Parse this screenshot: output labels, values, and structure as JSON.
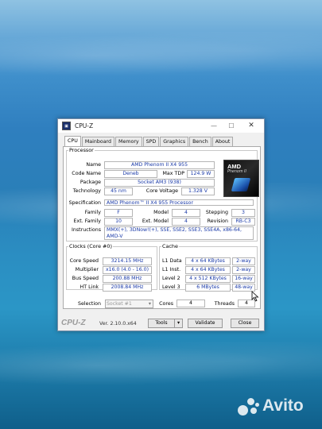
{
  "window": {
    "title": "CPU-Z"
  },
  "tabs": [
    "CPU",
    "Mainboard",
    "Memory",
    "SPD",
    "Graphics",
    "Bench",
    "About"
  ],
  "processor": {
    "legend": "Processor",
    "name_label": "Name",
    "name": "AMD Phenom II X4 955",
    "codename_label": "Code Name",
    "codename": "Deneb",
    "maxtdp_label": "Max TDP",
    "maxtdp": "124.9 W",
    "package_label": "Package",
    "package": "Socket AM3 (938)",
    "technology_label": "Technology",
    "technology": "45 nm",
    "corevoltage_label": "Core Voltage",
    "corevoltage": "1.328 V",
    "spec_label": "Specification",
    "spec": "AMD Phenom™ II X4 955 Processor",
    "family_label": "Family",
    "family": "F",
    "model_label": "Model",
    "model": "4",
    "stepping_label": "Stepping",
    "stepping": "3",
    "extfamily_label": "Ext. Family",
    "extfamily": "10",
    "extmodel_label": "Ext. Model",
    "extmodel": "4",
    "revision_label": "Revision",
    "revision": "RB-C3",
    "instructions_label": "Instructions",
    "instructions_line1": "MMX(+), 3DNow!(+), SSE, SSE2, SSE3, SSE4A, x86-64,",
    "instructions_line2": "AMD-V",
    "logo_brand": "AMD",
    "logo_sub": "Phenom II"
  },
  "clocks": {
    "legend": "Clocks (Core #0)",
    "corespeed_label": "Core Speed",
    "corespeed": "3214.15 MHz",
    "multiplier_label": "Multiplier",
    "multiplier": "x16.0 (4.0 - 16.0)",
    "busspeed_label": "Bus Speed",
    "busspeed": "200.88 MHz",
    "htlink_label": "HT Link",
    "htlink": "2008.84 MHz"
  },
  "cache": {
    "legend": "Cache",
    "l1d_label": "L1 Data",
    "l1d": "4 x 64 KBytes",
    "l1d_way": "2-way",
    "l1i_label": "L1 Inst.",
    "l1i": "4 x 64 KBytes",
    "l1i_way": "2-way",
    "l2_label": "Level 2",
    "l2": "4 x 512 KBytes",
    "l2_way": "16-way",
    "l3_label": "Level 3",
    "l3": "6 MBytes",
    "l3_way": "48-way"
  },
  "selection": {
    "selection_label": "Selection",
    "socket": "Socket #1",
    "cores_label": "Cores",
    "cores": "4",
    "threads_label": "Threads",
    "threads": "4"
  },
  "footer": {
    "logo": "CPU-Z",
    "version": "Ver. 2.10.0.x64",
    "tools": "Tools",
    "validate": "Validate",
    "close": "Close"
  },
  "watermark": {
    "text": "Avito"
  }
}
